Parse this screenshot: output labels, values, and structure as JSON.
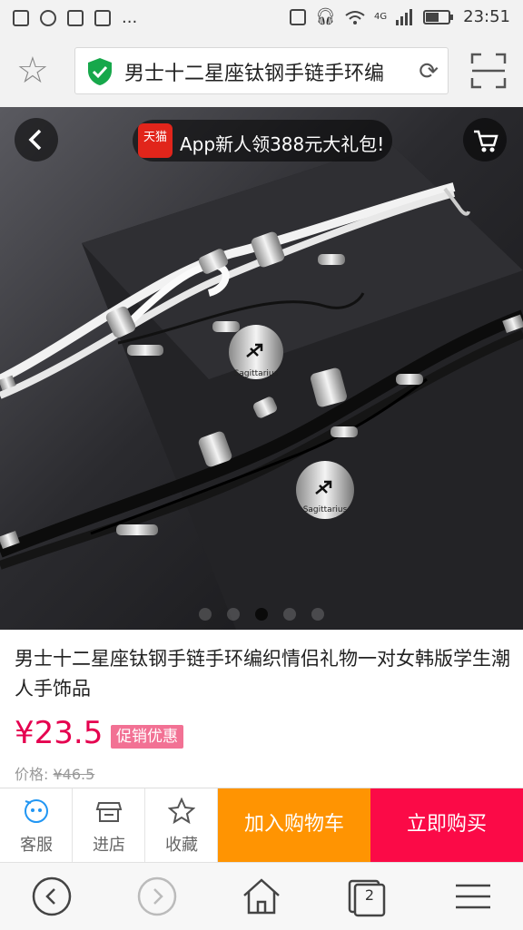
{
  "status_bar": {
    "left_indicator": "...",
    "network": "4G",
    "time": "23:51"
  },
  "address_bar": {
    "url_text": "男士十二星座钛钢手链手环编"
  },
  "hero": {
    "promo_badge": "天猫",
    "promo_text": "App新人领388元大礼包!",
    "charm_text_1": "Sagittarius",
    "charm_text_2": "Sagittarius",
    "slide_count": 5,
    "active_slide": 3
  },
  "product": {
    "title": "男士十二星座钛钢手链手环编织情侣礼物一对女韩版学生潮人手饰品",
    "price": "¥23.5",
    "promo_tag": "促销优惠",
    "orig_label": "价格: ",
    "orig_price": "¥46.5"
  },
  "actions": {
    "service_label": "客服",
    "shop_label": "进店",
    "favorite_label": "收藏",
    "add_cart_label": "加入购物车",
    "buy_now_label": "立即购买"
  },
  "nav": {
    "tab_count": "2"
  },
  "colors": {
    "price": "#e5004f",
    "add_cart": "#ff9402",
    "buy_now": "#fb0a47",
    "promo_tag": "#f27194",
    "secure": "#17a84b"
  }
}
